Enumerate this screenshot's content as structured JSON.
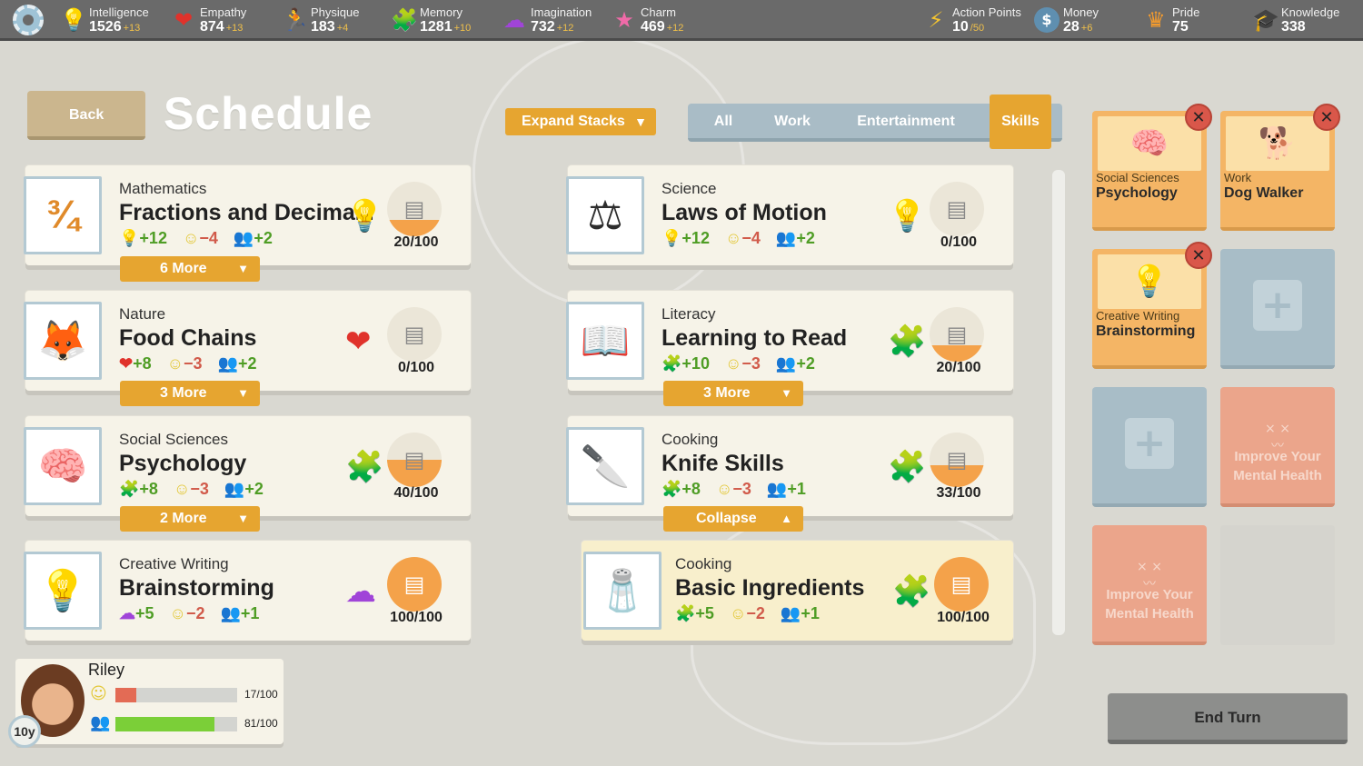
{
  "stats": [
    {
      "name": "Intelligence",
      "value": "1526",
      "delta": "+13",
      "icon": "lightbulb-icon",
      "glyph": "💡"
    },
    {
      "name": "Empathy",
      "value": "874",
      "delta": "+13",
      "icon": "heart-icon",
      "glyph": "❤"
    },
    {
      "name": "Physique",
      "value": "183",
      "delta": "+4",
      "icon": "runner-icon",
      "glyph": "🏃"
    },
    {
      "name": "Memory",
      "value": "1281",
      "delta": "+10",
      "icon": "puzzle-icon",
      "glyph": "🧩"
    },
    {
      "name": "Imagination",
      "value": "732",
      "delta": "+12",
      "icon": "cloud-icon",
      "glyph": "☁"
    },
    {
      "name": "Charm",
      "value": "469",
      "delta": "+12",
      "icon": "star-icon",
      "glyph": "★"
    },
    {
      "name": "Action Points",
      "value": "10",
      "delta": "/50",
      "icon": "lightning-icon",
      "glyph": "⚡"
    },
    {
      "name": "Money",
      "value": "28",
      "delta": "+6",
      "icon": "coin-icon",
      "glyph": "$"
    },
    {
      "name": "Pride",
      "value": "75",
      "delta": "",
      "icon": "crown-icon",
      "glyph": "♛"
    },
    {
      "name": "Knowledge",
      "value": "338",
      "delta": "",
      "icon": "grad-cap-icon",
      "glyph": "🎓"
    }
  ],
  "header": {
    "back_label": "Back",
    "title": "Schedule",
    "expand_label": "Expand Stacks"
  },
  "filters": [
    "All",
    "Work",
    "Entertainment",
    "Skills"
  ],
  "active_filter": "Skills",
  "cards": [
    {
      "category": "Mathematics",
      "skill": "Fractions and Decima...",
      "effects": {
        "stat": "+12",
        "happy": "−4",
        "social": "+2"
      },
      "stat_glyph": "💡",
      "thumb_glyph": "¾",
      "progress": "20/100",
      "more": "6 More"
    },
    {
      "category": "Science",
      "skill": "Laws of Motion",
      "effects": {
        "stat": "+12",
        "happy": "−4",
        "social": "+2"
      },
      "stat_glyph": "💡",
      "thumb_glyph": "⚖",
      "progress": "0/100"
    },
    {
      "category": "Nature",
      "skill": "Food Chains",
      "effects": {
        "stat": "+8",
        "happy": "−3",
        "social": "+2"
      },
      "stat_glyph": "❤",
      "thumb_glyph": "🦊",
      "progress": "0/100",
      "more": "3 More"
    },
    {
      "category": "Literacy",
      "skill": "Learning to Read",
      "effects": {
        "stat": "+10",
        "happy": "−3",
        "social": "+2"
      },
      "stat_glyph": "🧩",
      "thumb_glyph": "📖",
      "progress": "20/100",
      "more": "3 More"
    },
    {
      "category": "Social Sciences",
      "skill": "Psychology",
      "effects": {
        "stat": "+8",
        "happy": "−3",
        "social": "+2"
      },
      "stat_glyph": "🧩",
      "thumb_glyph": "🧠",
      "progress": "40/100",
      "more": "2 More"
    },
    {
      "category": "Cooking",
      "skill": "Knife Skills",
      "effects": {
        "stat": "+8",
        "happy": "−3",
        "social": "+1"
      },
      "stat_glyph": "🧩",
      "thumb_glyph": "🔪",
      "progress": "33/100",
      "collapse": "Collapse"
    },
    {
      "category": "Creative Writing",
      "skill": "Brainstorming",
      "effects": {
        "stat": "+5",
        "happy": "−2",
        "social": "+1"
      },
      "stat_glyph": "☁",
      "thumb_glyph": "💡",
      "progress": "100/100"
    },
    {
      "category": "Cooking",
      "skill": "Basic Ingredients",
      "effects": {
        "stat": "+5",
        "happy": "−2",
        "social": "+1"
      },
      "stat_glyph": "🧩",
      "thumb_glyph": "🧂",
      "progress": "100/100"
    }
  ],
  "scheduled": [
    {
      "category": "Social Sciences",
      "name": "Psychology",
      "glyph": "🧠"
    },
    {
      "category": "Work",
      "name": "Dog Walker",
      "glyph": "🐕"
    },
    {
      "category": "Creative Writing",
      "name": "Brainstorming",
      "glyph": "💡"
    }
  ],
  "mental_health_label": "Improve Your Mental Health",
  "character": {
    "name": "Riley",
    "age": "10y",
    "happiness": "17/100",
    "happiness_value": 0.17,
    "social": "81/100",
    "social_value": 0.81
  },
  "end_turn_label": "End Turn"
}
